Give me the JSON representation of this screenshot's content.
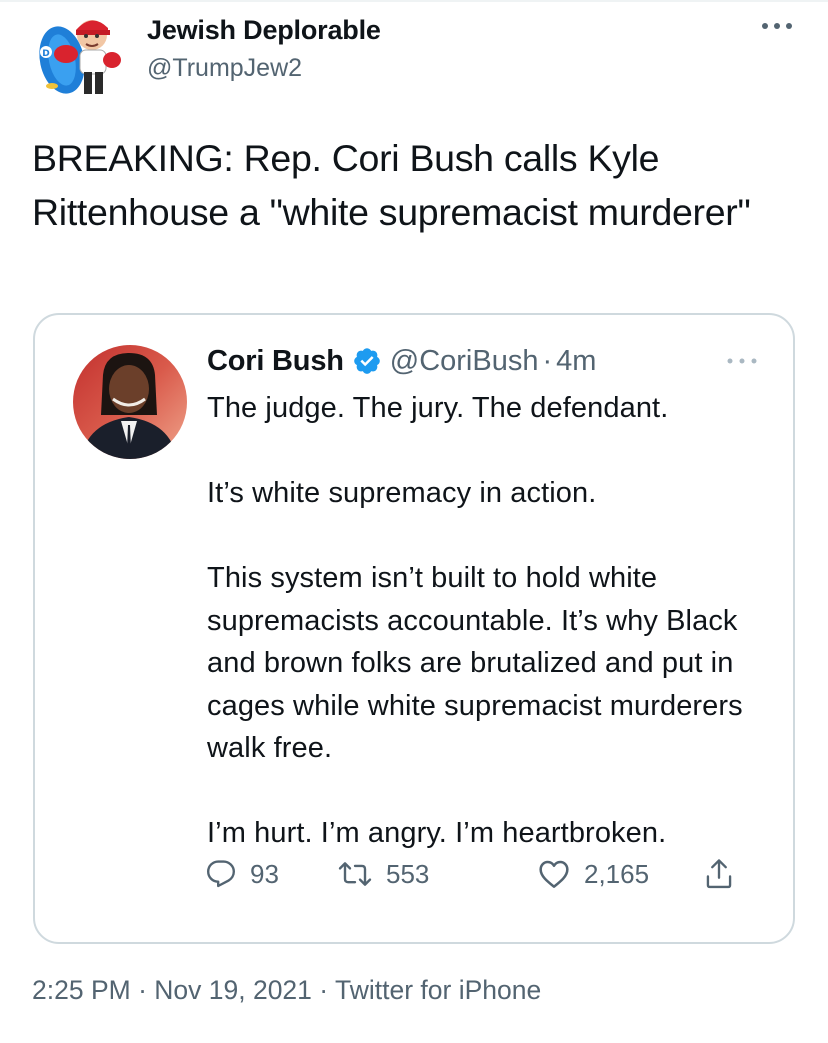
{
  "author": {
    "name": "Jewish Deplorable",
    "handle": "@TrumpJew2",
    "avatar_icon": "boxing-glove-avatar-icon"
  },
  "tweet": {
    "text": "BREAKING: Rep. Cori Bush calls Kyle Rittenhouse a \"white supremacist murderer\""
  },
  "quoted": {
    "name": "Cori Bush",
    "verified_icon": "verified-badge-icon",
    "handle": "@CoriBush",
    "separator": "·",
    "time": "4m",
    "paragraphs": [
      "The judge. The jury. The defendant.",
      "It’s white supremacy in action.",
      "This system isn’t built to hold white supremacists accountable. It’s why Black and brown folks are brutalized and put in cages while white supremacist murderers walk free.",
      "I’m hurt. I’m angry. I’m heartbroken."
    ],
    "stats": {
      "replies": "93",
      "retweets": "553",
      "likes": "2,165"
    }
  },
  "meta": {
    "time": "2:25 PM",
    "sep1": " · ",
    "date": "Nov 19, 2021",
    "sep2": " · ",
    "source": "Twitter for iPhone"
  },
  "colors": {
    "text": "#0f1419",
    "secondary": "#536471",
    "border": "#cfd9de",
    "verified": "#1d9bf0"
  }
}
